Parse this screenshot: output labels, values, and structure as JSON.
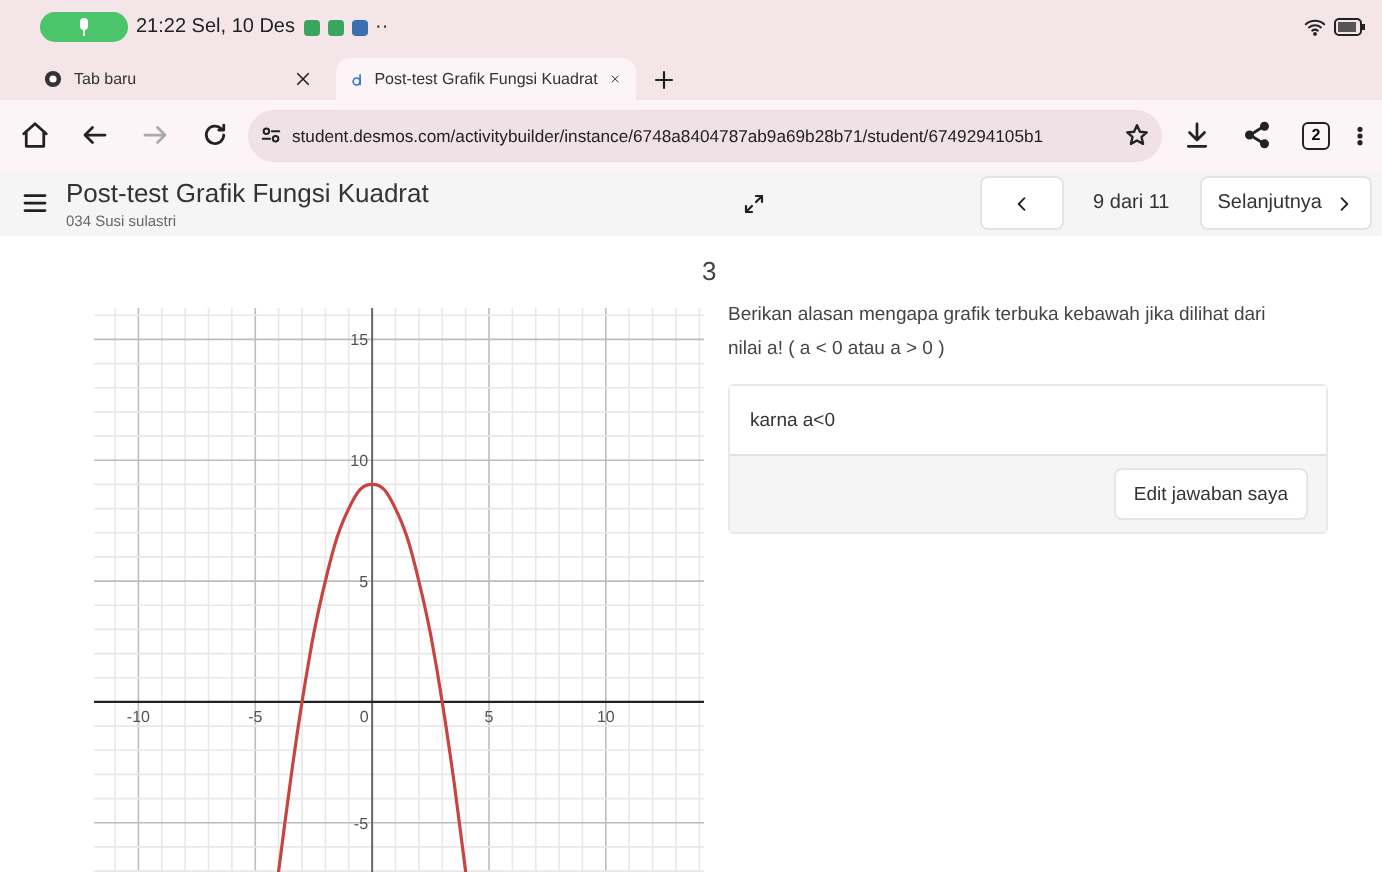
{
  "status_bar": {
    "time": "21:22 Sel, 10 Des",
    "more": "··"
  },
  "browser_tabs": [
    {
      "title": "Tab baru",
      "selected": false
    },
    {
      "title": "Post-test Grafik Fungsi Kuadrat",
      "selected": true
    }
  ],
  "address_bar": {
    "url": "student.desmos.com/activitybuilder/instance/6748a8404787ab9a69b28b71/student/6749294105b1",
    "tab_count": "2"
  },
  "header": {
    "title": "Post-test Grafik Fungsi Kuadrat",
    "subtitle": "034 Susi sulastri",
    "page": "9 dari 11",
    "next": "Selanjutnya"
  },
  "screen_number": "3",
  "graph": {
    "chart_data": {
      "type": "line",
      "grid": true,
      "x": [
        -4.05,
        -3.5,
        -3,
        -2.5,
        -2,
        -1.5,
        -1,
        -0.5,
        0,
        0.5,
        1,
        1.5,
        2,
        2.5,
        3,
        3.5,
        4.05
      ],
      "series": [
        {
          "color": "#c74440",
          "values": [
            -7.4,
            -3.3,
            0,
            2.8,
            5,
            6.8,
            8,
            8.8,
            9,
            8.8,
            8,
            6.8,
            5,
            2.8,
            0,
            -3.3,
            -7.4
          ]
        }
      ],
      "xlim": [
        -11.9,
        14.2
      ],
      "ylim": [
        -7.7,
        16.3
      ],
      "xticks": [
        -10,
        -5,
        0,
        5,
        10
      ],
      "yticks": [
        -5,
        5,
        10,
        15
      ]
    }
  },
  "question": "Berikan alasan mengapa grafik terbuka kebawah jika dilihat dari nilai a! ( a < 0 atau a > 0 )",
  "answer": "karna a<0",
  "edit_button": "Edit jawaban saya"
}
